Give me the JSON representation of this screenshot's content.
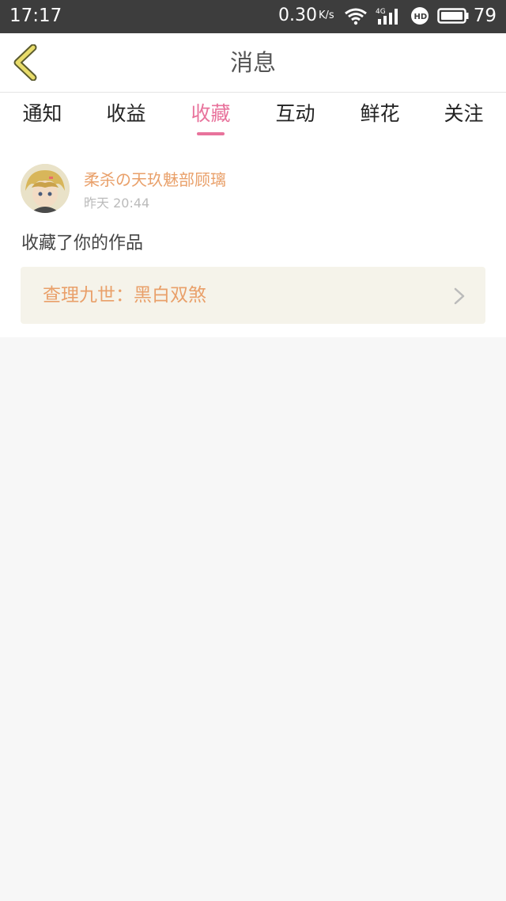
{
  "status_bar": {
    "time": "17:17",
    "net_speed": "0.30",
    "net_unit": "K/s",
    "icons": [
      "wifi-icon",
      "signal-4g-icon",
      "hd-icon",
      "battery-icon"
    ],
    "battery_level": "79"
  },
  "header": {
    "title": "消息",
    "back_icon": "chevron-left-icon"
  },
  "tabs": [
    {
      "label": "通知",
      "active": false
    },
    {
      "label": "收益",
      "active": false
    },
    {
      "label": "收藏",
      "active": true
    },
    {
      "label": "互动",
      "active": false
    },
    {
      "label": "鲜花",
      "active": false
    },
    {
      "label": "关注",
      "active": false
    }
  ],
  "message": {
    "sender_name": "柔杀の天玖魅部顾璃",
    "time": "昨天 20:44",
    "text": "收藏了你的作品",
    "work_title": "查理九世：黑白双煞"
  },
  "colors": {
    "accent": "#e8739c",
    "name_color": "#e9a06a",
    "back_icon": "#e8dc6a",
    "background": "#f7f7f7"
  }
}
